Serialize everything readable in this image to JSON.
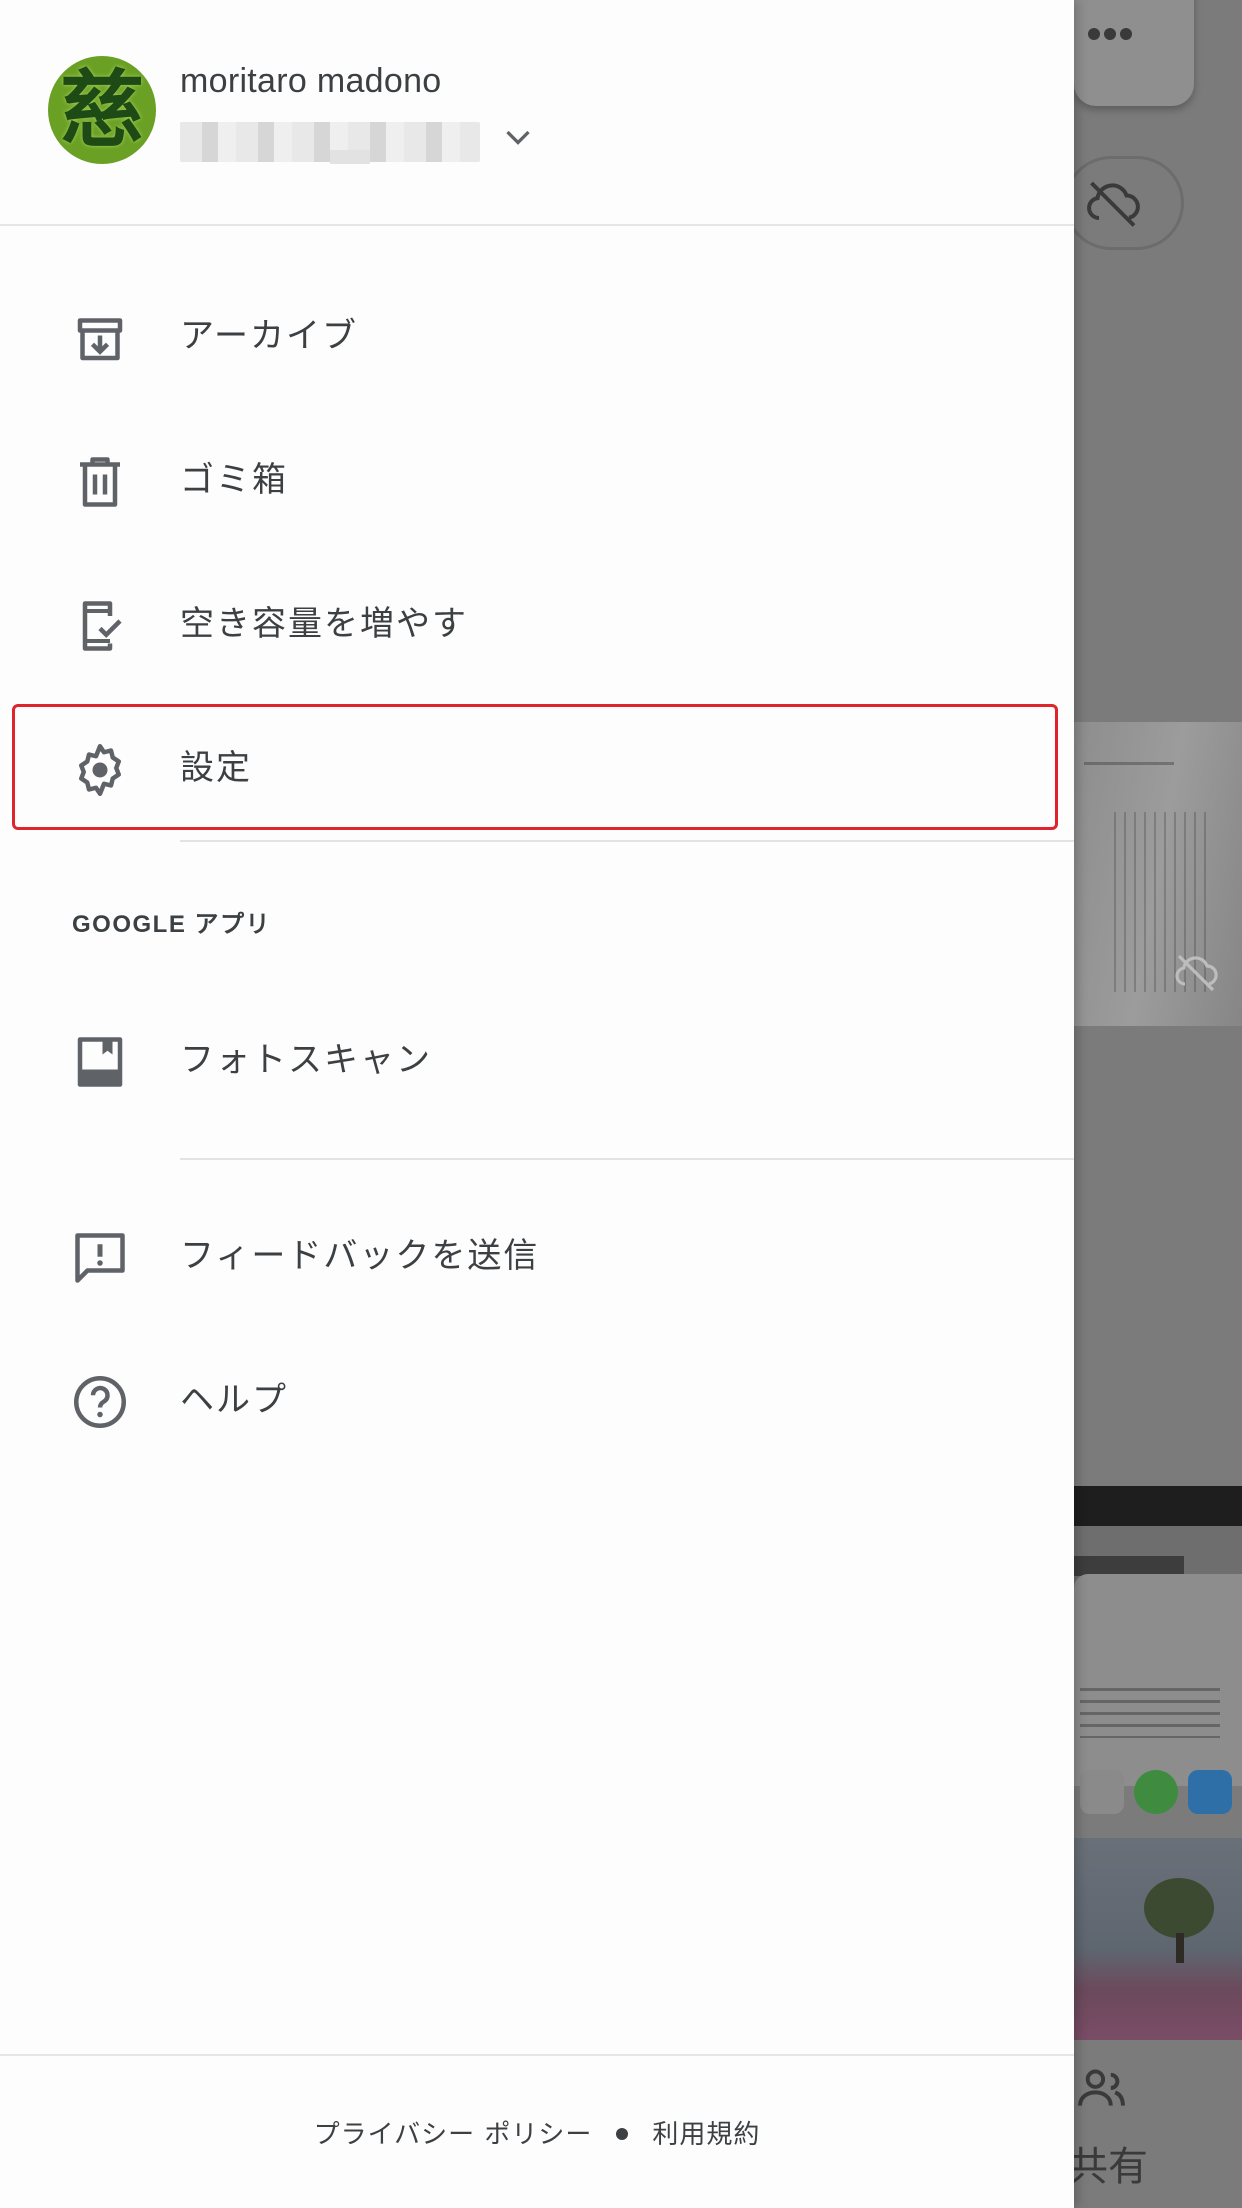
{
  "account": {
    "name": "moritaro madono",
    "avatar_glyph": "慈"
  },
  "menu": [
    {
      "id": "archive",
      "label": "アーカイブ",
      "icon": "archive-icon"
    },
    {
      "id": "trash",
      "label": "ゴミ箱",
      "icon": "trash-icon"
    },
    {
      "id": "free-up-space",
      "label": "空き容量を増やす",
      "icon": "device-check-icon"
    },
    {
      "id": "settings",
      "label": "設定",
      "icon": "gear-icon"
    }
  ],
  "google_apps": {
    "section_label": "GOOGLE アプリ",
    "items": [
      {
        "id": "photoscan",
        "label": "フォトスキャン",
        "icon": "photoscan-icon"
      }
    ]
  },
  "support": [
    {
      "id": "feedback",
      "label": "フィードバックを送信",
      "icon": "feedback-icon"
    },
    {
      "id": "help",
      "label": "ヘルプ",
      "icon": "help-icon"
    }
  ],
  "footer": {
    "privacy": "プライバシー ポリシー",
    "terms": "利用規約"
  },
  "background": {
    "share_label": "共有"
  },
  "colors": {
    "highlight": "#e0242b",
    "text": "#3c4043",
    "icon": "#5f6368"
  }
}
